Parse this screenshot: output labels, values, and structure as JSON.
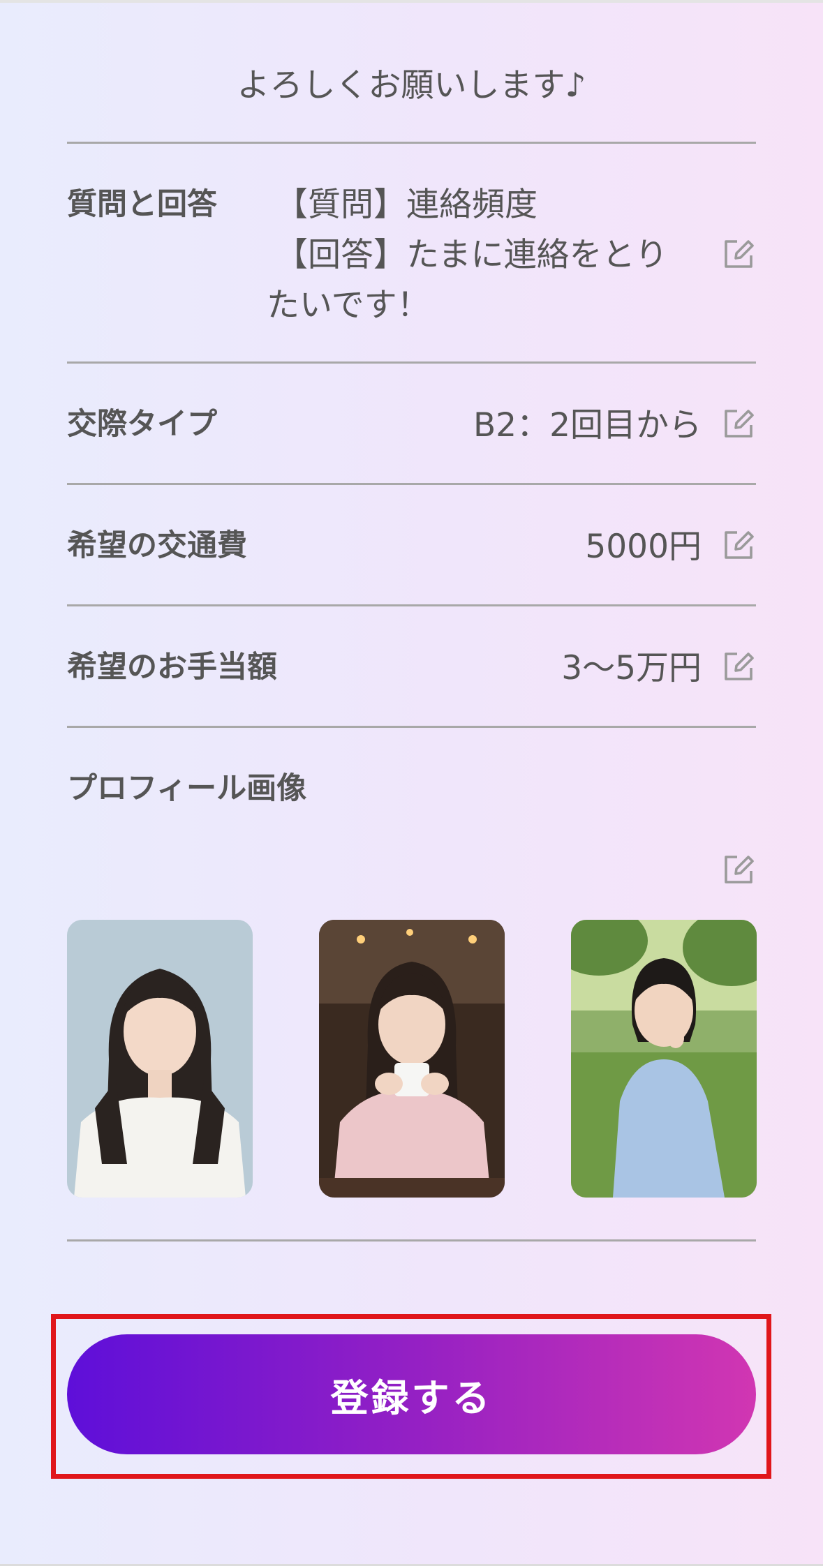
{
  "intro_text": "よろしくお願いします♪",
  "rows": {
    "qa": {
      "label": "質問と回答",
      "question": "【質問】連絡頻度",
      "answer_line1": "【回答】たまに連絡をとり",
      "answer_line2": "たいです！"
    },
    "relationship_type": {
      "label": "交際タイプ",
      "value": "B2：2回目から"
    },
    "transport": {
      "label": "希望の交通費",
      "value": "5000円"
    },
    "allowance": {
      "label": "希望のお手当額",
      "value": "3〜5万円"
    },
    "profile_images": {
      "label": "プロフィール画像"
    }
  },
  "photos": [
    {
      "name": "profile-photo-white-tshirt"
    },
    {
      "name": "profile-photo-cafe-cup"
    },
    {
      "name": "profile-photo-park-dress"
    }
  ],
  "icons": {
    "edit": "pencil-square-icon"
  },
  "submit_button": {
    "label": "登録する"
  },
  "colors": {
    "button_start": "#5e0fd9",
    "button_end": "#d136b2",
    "highlight_border": "#e0161b",
    "divider": "#a8a8a8"
  }
}
